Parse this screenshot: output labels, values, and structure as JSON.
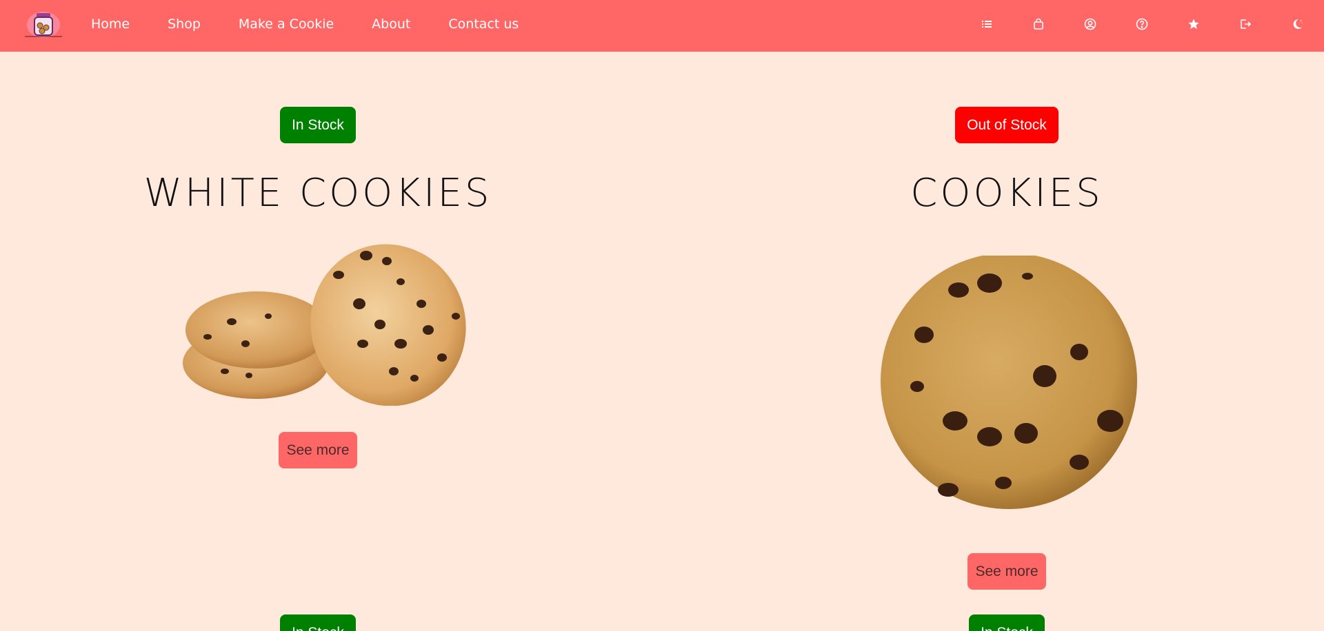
{
  "nav": {
    "links": [
      "Home",
      "Shop",
      "Make a Cookie",
      "About",
      "Contact us"
    ],
    "icons": [
      "list-icon",
      "shopping-bag-icon",
      "user-icon",
      "help-icon",
      "star-icon",
      "logout-icon",
      "moon-icon"
    ]
  },
  "colors": {
    "navbar": "#ff6767",
    "background": "#ffe9dd",
    "in_stock": "#008000",
    "out_of_stock": "#ff0000",
    "see_more": "#ff6767"
  },
  "products": [
    {
      "stock_label": "In Stock",
      "title": "WHITE COOKIES",
      "button": "See more"
    },
    {
      "stock_label": "Out of Stock",
      "title": "COOKIES",
      "button": "See more"
    },
    {
      "stock_label": "In Stock"
    },
    {
      "stock_label": "In Stock"
    }
  ]
}
